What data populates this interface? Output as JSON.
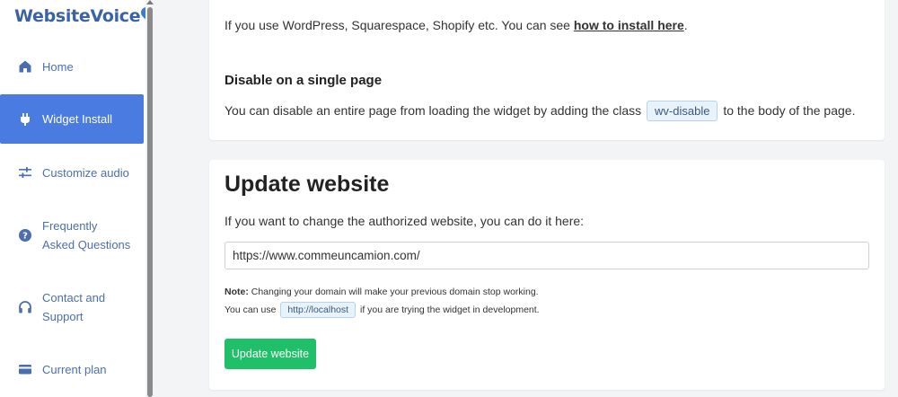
{
  "brand": {
    "name": "WebsiteVoice"
  },
  "sidebar": {
    "items": [
      {
        "label": "Home",
        "icon": "home-icon"
      },
      {
        "label": "Widget Install",
        "icon": "plug-icon",
        "active": true
      },
      {
        "label": "Customize audio",
        "icon": "sliders-icon"
      },
      {
        "label_line1": "Frequently",
        "label_line2": "Asked Questions",
        "icon": "help-icon"
      },
      {
        "label_line1": "Contact and",
        "label_line2": "Support",
        "icon": "headphones-icon"
      },
      {
        "label": "Current plan",
        "icon": "credit-card-icon"
      }
    ]
  },
  "install_card": {
    "intro_prefix": "If you use WordPress, Squarespace, Shopify etc. You can see ",
    "intro_link": "how to install here",
    "intro_suffix": ".",
    "disable_heading": "Disable on a single page",
    "disable_prefix": "You can disable an entire page from loading the widget by adding the class",
    "disable_class": "wv-disable",
    "disable_suffix": "to the body of the page."
  },
  "update_card": {
    "title": "Update website",
    "description": "If you want to change the authorized website, you can do it here:",
    "website_value": "https://www.commeuncamion.com/",
    "note_label": "Note:",
    "note_text": " Changing your domain will make your previous domain stop working.",
    "dev_prefix": "You can use",
    "dev_code": "http://localhost",
    "dev_suffix": "if you are trying the widget in development.",
    "button_label": "Update website"
  },
  "colors": {
    "brand": "#3a63a6",
    "sidebar_text": "#4b6fae",
    "active_item": "#4a7be0",
    "button": "#20c06a",
    "code_bg": "#e8f2fb"
  }
}
